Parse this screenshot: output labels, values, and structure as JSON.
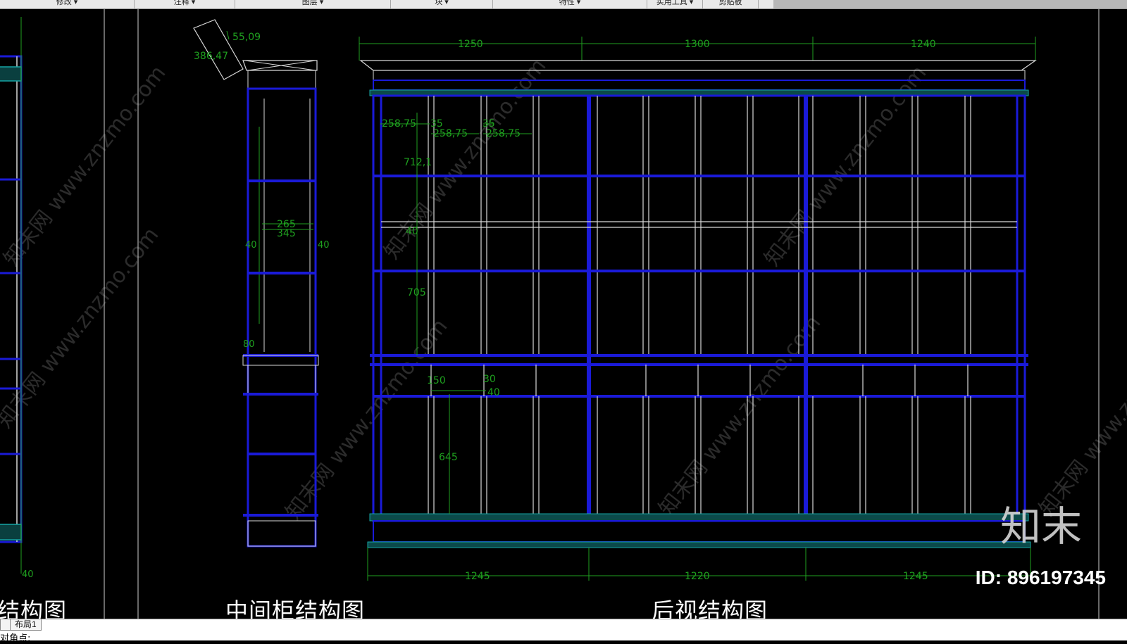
{
  "ribbon": {
    "panels": [
      "修改 ▾",
      "注释 ▾",
      "图层 ▾",
      "块 ▾",
      "特性 ▾",
      "实用工具 ▾",
      "剪贴板"
    ]
  },
  "drawing": {
    "titles": {
      "left_partial": "结构图",
      "middle": "中间柜结构图",
      "right": "后视结构图"
    },
    "dimensions": {
      "top_1": "1250",
      "top_2": "1300",
      "top_3": "1240",
      "bottom_1": "1245",
      "bottom_2": "1220",
      "bottom_3": "1245",
      "d_258_75_a": "258,75",
      "d_35_a": "35",
      "d_35_b": "35",
      "d_258_75_b": "258,75",
      "d_258_75_c": "258,75",
      "d_712_1": "712,1",
      "d_40_mid": "40",
      "d_705": "705",
      "d_150": "150",
      "d_30": "30",
      "d_40_b": "40",
      "d_645": "645",
      "d_55_09": "55,09",
      "d_386_47": "386,47",
      "d_265": "265",
      "d_345": "345",
      "d_40_left": "40",
      "d_40_right": "40",
      "d_80": "80",
      "d_40_far_left": "40"
    },
    "watermark_text": "知末网 www.znzmo.com"
  },
  "watermark": {
    "logo": "知末",
    "id": "ID: 896197345"
  },
  "statusbar": {
    "tab_model": "",
    "tab_layout": "布局1",
    "command_prompt": "对角点:"
  },
  "colors": {
    "background": "#000000",
    "outline": "#1a1ad8",
    "lines": "#d8d8d8",
    "dimension": "#1fa11f",
    "molding": "#15a5a5"
  }
}
